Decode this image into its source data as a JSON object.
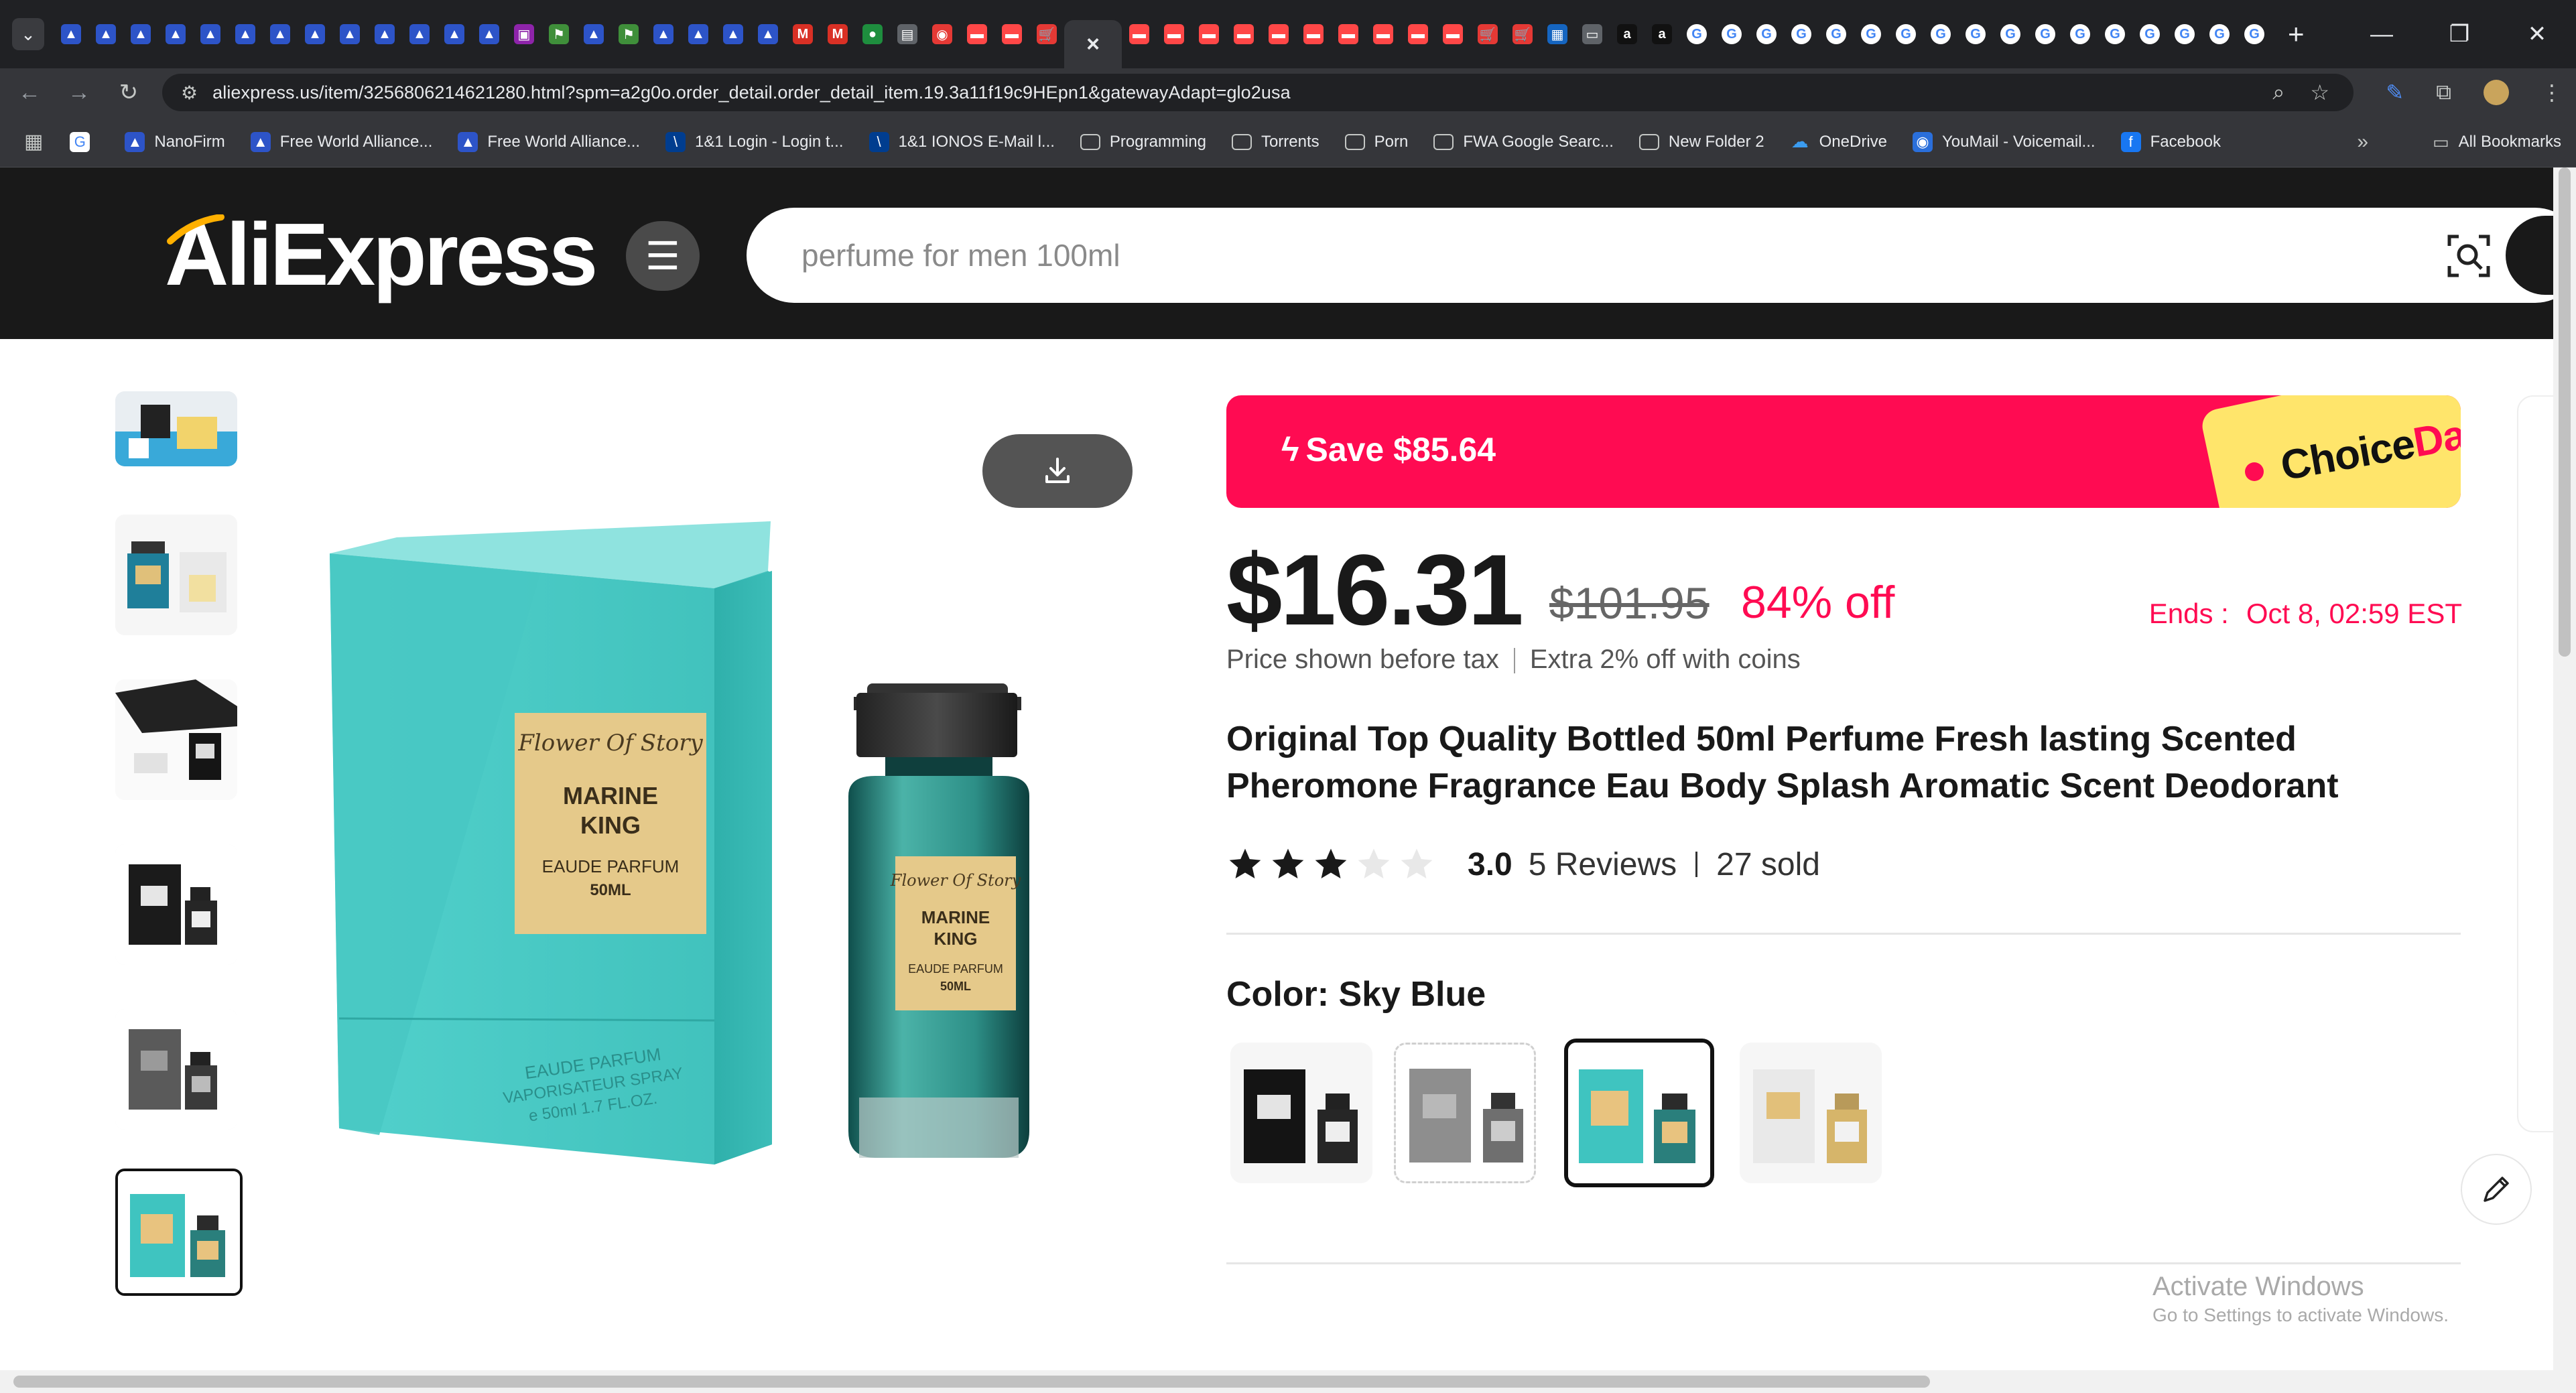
{
  "browser": {
    "tabs": [
      {
        "icon": "fwa-icon",
        "color": "#2d54c8"
      },
      {
        "icon": "fwa-icon",
        "color": "#2d54c8"
      },
      {
        "icon": "fwa-icon",
        "color": "#2d54c8"
      },
      {
        "icon": "fwa-icon",
        "color": "#2d54c8"
      },
      {
        "icon": "fwa-icon",
        "color": "#2d54c8"
      },
      {
        "icon": "fwa-icon",
        "color": "#2d54c8"
      },
      {
        "icon": "fwa-icon",
        "color": "#2d54c8"
      },
      {
        "icon": "fwa-icon",
        "color": "#2d54c8"
      },
      {
        "icon": "fwa-icon",
        "color": "#2d54c8"
      },
      {
        "icon": "fwa-icon",
        "color": "#2d54c8"
      },
      {
        "icon": "fwa-icon",
        "color": "#2d54c8"
      },
      {
        "icon": "fwa-icon",
        "color": "#2d54c8"
      },
      {
        "icon": "fwa-icon",
        "color": "#2d54c8"
      },
      {
        "icon": "purple-app-icon",
        "color": "#8e24aa"
      },
      {
        "icon": "flag-icon",
        "color": "#3f8f3a"
      },
      {
        "icon": "fwa-icon",
        "color": "#2d54c8"
      },
      {
        "icon": "flag-icon",
        "color": "#3f8f3a"
      },
      {
        "icon": "fwa-icon",
        "color": "#2d54c8"
      },
      {
        "icon": "fwa-icon",
        "color": "#2d54c8"
      },
      {
        "icon": "fwa-icon",
        "color": "#2d54c8"
      },
      {
        "icon": "fwa-icon",
        "color": "#2d54c8"
      },
      {
        "icon": "gmail-icon",
        "color": "#d93025"
      },
      {
        "icon": "gmail-icon",
        "color": "#d93025"
      },
      {
        "icon": "green-app-icon",
        "color": "#1e8e3e"
      },
      {
        "icon": "doc-icon",
        "color": "#5f6368"
      },
      {
        "icon": "red-circle-icon",
        "color": "#e53935"
      },
      {
        "icon": "aliexpress-icon",
        "color": "#ff4747"
      },
      {
        "icon": "aliexpress-icon",
        "color": "#ff4747"
      },
      {
        "icon": "cart-icon",
        "color": "#e53935"
      }
    ],
    "active_tab_close": "×",
    "tabs_after": [
      {
        "icon": "aliexpress-icon",
        "color": "#ff4747"
      },
      {
        "icon": "aliexpress-icon",
        "color": "#ff4747"
      },
      {
        "icon": "aliexpress-icon",
        "color": "#ff4747"
      },
      {
        "icon": "aliexpress-icon",
        "color": "#ff4747"
      },
      {
        "icon": "aliexpress-icon",
        "color": "#ff4747"
      },
      {
        "icon": "aliexpress-icon",
        "color": "#ff4747"
      },
      {
        "icon": "aliexpress-icon",
        "color": "#ff4747"
      },
      {
        "icon": "aliexpress-icon",
        "color": "#ff4747"
      },
      {
        "icon": "aliexpress-icon",
        "color": "#ff4747"
      },
      {
        "icon": "aliexpress-icon",
        "color": "#ff4747"
      },
      {
        "icon": "cart-icon",
        "color": "#e53935"
      },
      {
        "icon": "cart-icon",
        "color": "#e53935"
      },
      {
        "icon": "blue-app-icon",
        "color": "#1565c0"
      },
      {
        "icon": "screen-icon",
        "color": "#5f6368"
      },
      {
        "icon": "amazon-icon",
        "color": "#111111"
      },
      {
        "icon": "amazon-icon",
        "color": "#111111"
      },
      {
        "icon": "google-icon",
        "color": "#ffffff"
      },
      {
        "icon": "google-icon",
        "color": "#ffffff"
      },
      {
        "icon": "google-icon",
        "color": "#ffffff"
      },
      {
        "icon": "google-icon",
        "color": "#ffffff"
      },
      {
        "icon": "google-icon",
        "color": "#ffffff"
      },
      {
        "icon": "google-icon",
        "color": "#ffffff"
      },
      {
        "icon": "google-icon",
        "color": "#ffffff"
      },
      {
        "icon": "google-icon",
        "color": "#ffffff"
      },
      {
        "icon": "google-icon",
        "color": "#ffffff"
      },
      {
        "icon": "google-icon",
        "color": "#ffffff"
      },
      {
        "icon": "google-icon",
        "color": "#ffffff"
      },
      {
        "icon": "google-icon",
        "color": "#ffffff"
      },
      {
        "icon": "google-icon",
        "color": "#ffffff"
      },
      {
        "icon": "google-icon",
        "color": "#ffffff"
      },
      {
        "icon": "google-icon",
        "color": "#ffffff"
      },
      {
        "icon": "google-icon",
        "color": "#ffffff"
      },
      {
        "icon": "google-icon",
        "color": "#ffffff"
      }
    ],
    "new_tab": "+",
    "url": "aliexpress.us/item/3256806214621280.html?spm=a2g0o.order_detail.order_detail_item.19.3a11f19c9HEpn1&gatewayAdapt=glo2usa",
    "bookmarks": [
      {
        "label": "",
        "icon": "google-icon",
        "glyph": "G",
        "color": "#4285f4"
      },
      {
        "label": "NanoFirm",
        "icon": "fwa-icon",
        "glyph": "▲",
        "color": "#2d54c8"
      },
      {
        "label": "Free World Alliance...",
        "icon": "fwa-icon",
        "glyph": "▲",
        "color": "#2d54c8"
      },
      {
        "label": "Free World Alliance...",
        "icon": "fwa-icon",
        "glyph": "▲",
        "color": "#2d54c8"
      },
      {
        "label": "1&1 Login - Login t...",
        "icon": "ionos-icon",
        "glyph": "\\",
        "color": "#003d8f"
      },
      {
        "label": "1&1 IONOS E-Mail l...",
        "icon": "ionos-icon",
        "glyph": "\\",
        "color": "#003d8f"
      },
      {
        "label": "Programming",
        "icon": "folder-icon",
        "glyph": "▭",
        "color": "#35363a"
      },
      {
        "label": "Torrents",
        "icon": "folder-icon",
        "glyph": "▭",
        "color": "#35363a"
      },
      {
        "label": "Porn",
        "icon": "folder-icon",
        "glyph": "▭",
        "color": "#35363a"
      },
      {
        "label": "FWA Google Searc...",
        "icon": "folder-icon",
        "glyph": "▭",
        "color": "#35363a"
      },
      {
        "label": "New Folder 2",
        "icon": "folder-icon",
        "glyph": "▭",
        "color": "#35363a"
      },
      {
        "label": "OneDrive",
        "icon": "onedrive-icon",
        "glyph": "☁",
        "color": "#35363a"
      },
      {
        "label": "YouMail - Voicemail...",
        "icon": "youmail-icon",
        "glyph": "◉",
        "color": "#2a6fdb"
      },
      {
        "label": "Facebook",
        "icon": "facebook-icon",
        "glyph": "f",
        "color": "#1877f2"
      }
    ],
    "bookmarks_more": "»",
    "all_bookmarks": "All Bookmarks"
  },
  "header": {
    "logo_main": "liExpress",
    "logo_accent": "A",
    "search_placeholder": "perfume for men 100ml"
  },
  "gallery": {
    "active_index": 5,
    "product_label_brand": "Flower Of Story",
    "product_label_name_1": "MARINE",
    "product_label_name_2": "KING",
    "product_label_type": "EAUDE PARFUM",
    "product_label_size": "50ML",
    "box_bottom_1": "EAUDE PARFUM",
    "box_bottom_2": "VAPORISATEUR SPRAY",
    "box_bottom_3": "e 50ml  1.7 FL.OZ.",
    "bottle_label_type": "EAUDE PARFUM",
    "bottle_label_size": "50ML"
  },
  "deal": {
    "save_text": "Save $85.64",
    "choice": "Choice",
    "day": "Day"
  },
  "price": {
    "current": "$16.31",
    "original": "$101.95",
    "discount": "84% off",
    "ends_label": "Ends :",
    "ends_value": "Oct 8, 02:59 EST",
    "tax_note": "Price shown before tax",
    "coins_note": "Extra 2% off with coins"
  },
  "product": {
    "title": "Original Top Quality Bottled 50ml Perfume Fresh lasting Scented Pheromone Fragrance Eau Body Splash Aromatic Scent Deodorant",
    "rating": 3.0,
    "rating_text": "3.0",
    "reviews": "5 Reviews",
    "sold": "27 sold",
    "color_label": "Color: Sky Blue",
    "swatches": [
      {
        "name": "black",
        "selected": false
      },
      {
        "name": "grey",
        "selected": false
      },
      {
        "name": "sky-blue",
        "selected": true
      },
      {
        "name": "white",
        "selected": false
      }
    ]
  },
  "watermark": {
    "line1": "Activate Windows",
    "line2": "Go to Settings to activate Windows."
  },
  "colors": {
    "accent": "#ff0b52",
    "choice_yellow": "#ffe56b",
    "box_teal": "#3fc4c0",
    "header_bg": "#191919"
  }
}
